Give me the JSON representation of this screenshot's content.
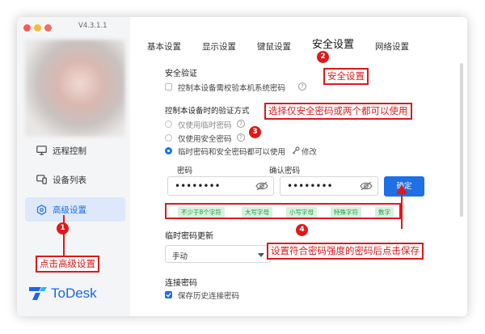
{
  "window": {
    "version": "V4.3.1.1"
  },
  "sidebar": {
    "items": [
      {
        "label": "远程控制",
        "icon": "monitor-icon"
      },
      {
        "label": "设备列表",
        "icon": "device-list-icon"
      },
      {
        "label": "高级设置",
        "icon": "gear-icon",
        "active": true
      }
    ],
    "logo_text": "ToDesk"
  },
  "tabs": [
    "基本设置",
    "显示设置",
    "键鼠设置",
    "安全设置",
    "网络设置"
  ],
  "active_tab": "安全设置",
  "security": {
    "section_title": "安全验证",
    "require_system_password_label": "控制本设备需校验本机系统密码",
    "require_system_password_checked": false,
    "verify_method_title": "控制本设备时的验证方式",
    "options": [
      {
        "label": "仅使用临时密码",
        "selected": false
      },
      {
        "label": "仅使用安全密码",
        "selected": false
      },
      {
        "label": "临时密码和安全密码都可以使用",
        "selected": true
      }
    ],
    "modify_label": "修改",
    "password_label": "密码",
    "password_value": "••••••••",
    "confirm_password_label": "确认密码",
    "confirm_password_value": "••••••••",
    "confirm_button": "确定",
    "rules": [
      "不少于8个字符",
      "大写字母",
      "小写字母",
      "特殊字符",
      "数字"
    ]
  },
  "temp_password": {
    "title": "临时密码更新",
    "selected": "手动"
  },
  "connection_password": {
    "title": "连接密码",
    "save_history_label": "保存历史连接密码",
    "save_history_checked": true
  },
  "annotations": {
    "step1_badge": "1",
    "step1_text": "点击高级设置",
    "step2_badge": "2",
    "step2_text": "安全设置",
    "step3_badge": "3",
    "step3_text": "选择仅安全密码或两个都可以使用",
    "step4_badge": "4",
    "step4_text": "设置符合密码强度的密码后点击保存"
  },
  "colors": {
    "accent": "#1f6fe5",
    "annotation": "#e01818",
    "rule_tag_bg": "#d7f1dd",
    "rule_tag_text": "#1e9e45"
  }
}
